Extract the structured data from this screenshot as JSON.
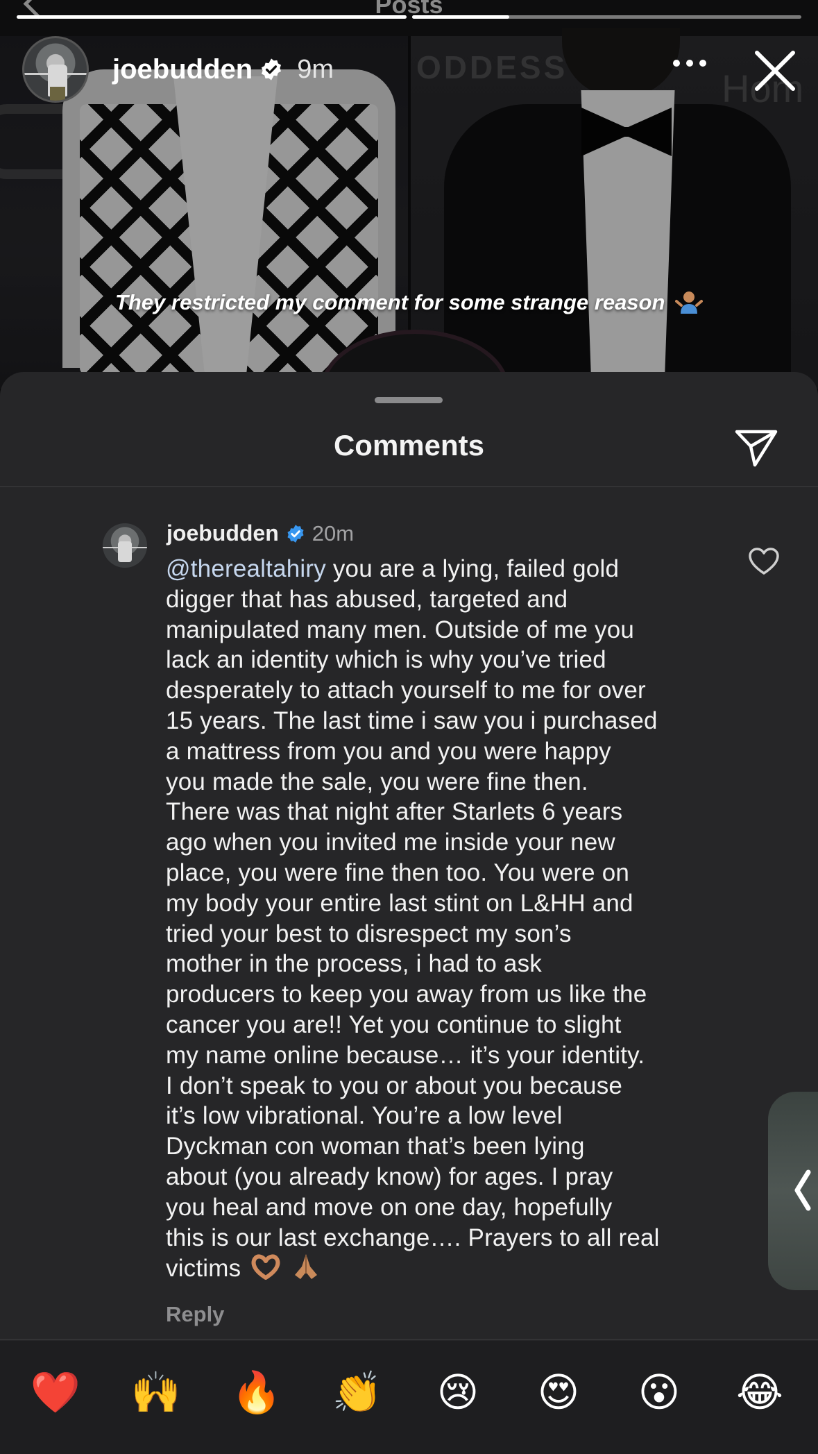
{
  "top_bar": {
    "title": "Posts"
  },
  "story": {
    "username": "joebudden",
    "time_ago": "9m",
    "caption": "They restricted my comment for some strange reason",
    "progress": [
      1.0,
      0.25
    ],
    "sign_left": "ODDESS",
    "sign_right": "Hom"
  },
  "comments_sheet": {
    "title": "Comments",
    "comment": {
      "username": "joebudden",
      "time_ago": "20m",
      "mention": "@therealtahiry",
      "lines": [
        " you are a lying, failed gold",
        "digger that has abused, targeted and",
        "manipulated many men. Outside of me you",
        "lack an identity which is why you’ve tried",
        "desperately to attach yourself to me for over",
        "15 years. The last time i saw you i purchased",
        "a mattress from you and you were happy",
        "you made the  sale, you were fine then.",
        "There was that night after Starlets 6 years",
        "ago when you invited me inside your new",
        "place, you were fine then too. You were on",
        "my body your entire last stint on L&HH and",
        "tried your best to disrespect my son’s",
        "mother in the process, i had to ask",
        "producers to keep you away from us like the",
        "cancer you are!! Yet you continue to slight",
        "my name online because… it’s your identity.",
        "I don’t speak to you or about you because",
        "it’s low vibrational. You’re a low level",
        "Dyckman con woman that’s been lying",
        "about (you already know) for ages. I pray",
        "you heal and move on one day, hopefully",
        "this is our last exchange…. Prayers to all real",
        "victims"
      ],
      "trailing_emojis": [
        "heart-hands-emoji",
        "praying-hands-emoji"
      ],
      "reply_label": "Reply"
    }
  },
  "reactions": [
    "❤️",
    "🙌",
    "🔥",
    "👏",
    "😢",
    "😍",
    "😮",
    "😂"
  ],
  "colors": {
    "sheet_bg": "#262628",
    "mention": "#c6d7ee",
    "verified_blue": "#3897f0",
    "muted": "#8e8e90"
  }
}
